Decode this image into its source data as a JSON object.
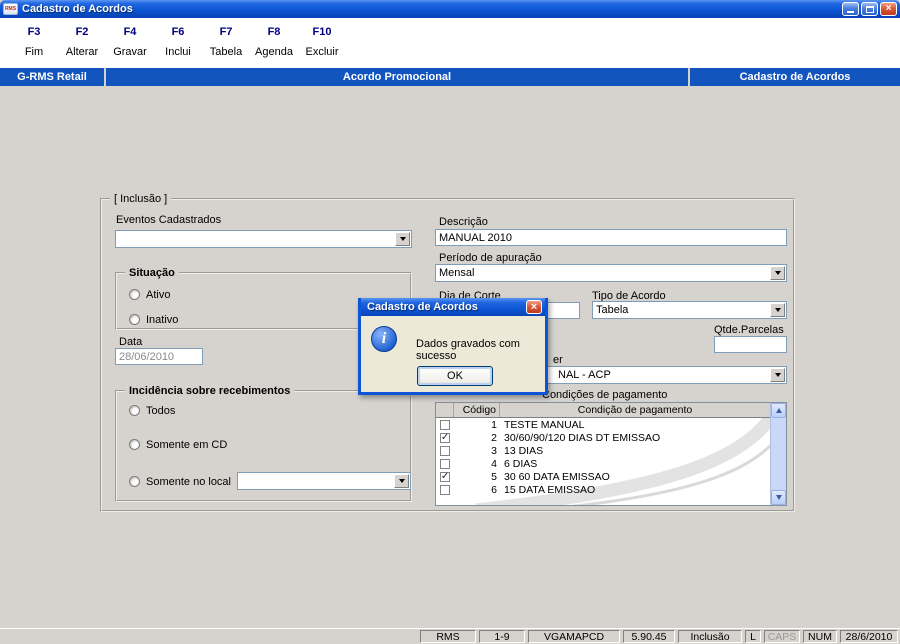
{
  "window": {
    "title": "Cadastro de Acordos",
    "icon_text": "RMS"
  },
  "toolbar": {
    "items": [
      {
        "key": "F3",
        "label": "Fim"
      },
      {
        "key": "F2",
        "label": "Alterar"
      },
      {
        "key": "F4",
        "label": "Gravar"
      },
      {
        "key": "F6",
        "label": "Inclui"
      },
      {
        "key": "F7",
        "label": "Tabela"
      },
      {
        "key": "F8",
        "label": "Agenda"
      },
      {
        "key": "F10",
        "label": "Excluir"
      }
    ]
  },
  "header": {
    "left": "G-RMS Retail",
    "center": "Acordo Promocional",
    "right": "Cadastro de Acordos"
  },
  "form": {
    "group_label": "[ Inclusão ]",
    "eventos": {
      "label": "Eventos Cadastrados",
      "value": ""
    },
    "situacao": {
      "legend": "Situação",
      "options": [
        {
          "label": "Ativo"
        },
        {
          "label": "Inativo"
        }
      ]
    },
    "data_field": {
      "label": "Data",
      "value": "28/06/2010"
    },
    "incidencia": {
      "legend": "Incidência sobre recebimentos",
      "options": [
        {
          "label": "Todos"
        },
        {
          "label": "Somente em CD"
        },
        {
          "label": "Somente no local"
        }
      ],
      "local_value": ""
    },
    "descricao": {
      "label": "Descrição",
      "value": "MANUAL 2010"
    },
    "periodo": {
      "label": "Período de apuração",
      "value": "Mensal"
    },
    "dia_corte": {
      "label": "Dia de Corte",
      "value": ""
    },
    "tipo": {
      "label": "Tipo de Acordo",
      "value": "Tabela"
    },
    "parcelas": {
      "label": "Qtde.Parcelas",
      "value": ""
    },
    "partial_label": "er",
    "acordo_combo": {
      "visible_value": "NAL - ACP"
    },
    "condicoes": {
      "label": "Condições de pagamento",
      "columns": [
        "Código",
        "Condição de pagamento"
      ],
      "rows": [
        {
          "checked": false,
          "codigo": "1",
          "condicao": "TESTE MANUAL"
        },
        {
          "checked": true,
          "codigo": "2",
          "condicao": "30/60/90/120 DIAS DT EMISSAO"
        },
        {
          "checked": false,
          "codigo": "3",
          "condicao": "13 DIAS"
        },
        {
          "checked": false,
          "codigo": "4",
          "condicao": "6 DIAS"
        },
        {
          "checked": true,
          "codigo": "5",
          "condicao": "30 60 DATA EMISSAO"
        },
        {
          "checked": false,
          "codigo": "6",
          "condicao": "15 DATA EMISSAO"
        }
      ]
    }
  },
  "dialog": {
    "title": "Cadastro de Acordos",
    "message": "Dados gravados com sucesso",
    "ok_label": "OK"
  },
  "statusbar": {
    "items": [
      {
        "label": "RMS"
      },
      {
        "label": "1-9"
      },
      {
        "label": "VGAMAPCD"
      },
      {
        "label": "5.90.45"
      },
      {
        "label": "Inclusão"
      },
      {
        "label": "L"
      },
      {
        "label": "CAPS",
        "dim": true
      },
      {
        "label": "NUM"
      },
      {
        "label": "28/6/2010"
      }
    ]
  },
  "colors": {
    "titlebar_blue": "#0c55d6",
    "header_blue": "#1355be",
    "chrome_gray": "#d6d3ce"
  }
}
